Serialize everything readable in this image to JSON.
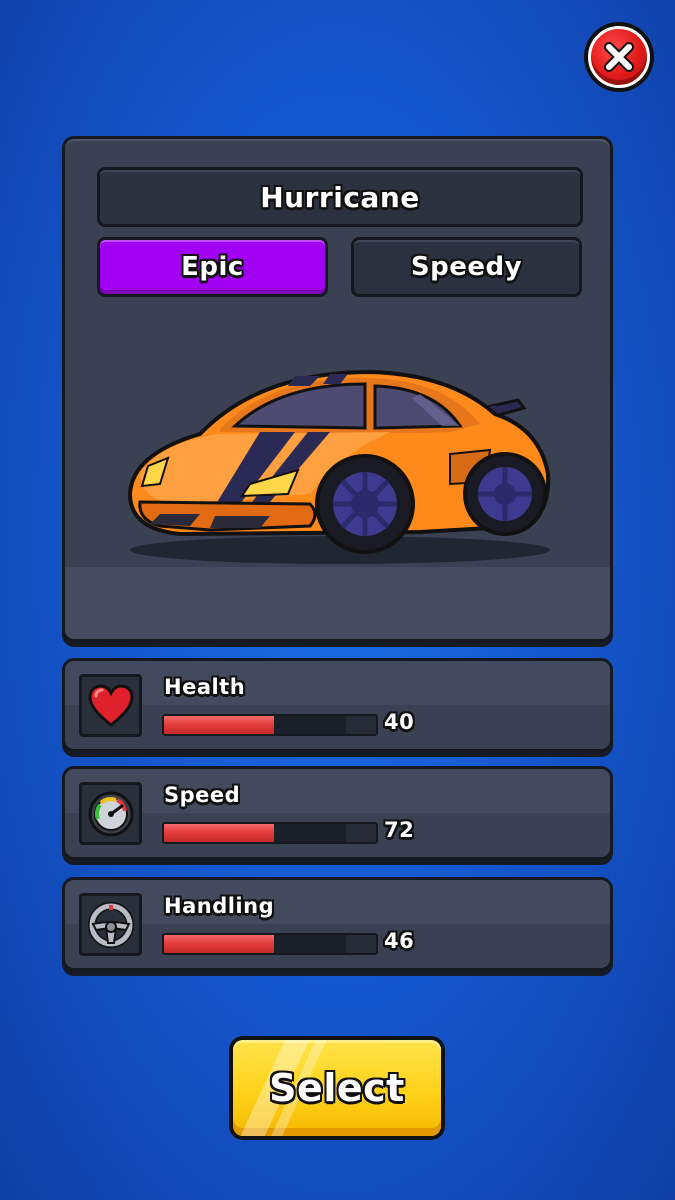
{
  "close_button": {
    "icon": "close-icon"
  },
  "car": {
    "name": "Hurricane",
    "rarity": "Epic",
    "type": "Speedy",
    "rarity_color": "#a200f2",
    "body_color": "#ff8a1c",
    "wheel_color": "#3d3a8f"
  },
  "stats": [
    {
      "label": "Health",
      "icon": "heart-icon",
      "value": "40",
      "level": 0.52
    },
    {
      "label": "Speed",
      "icon": "speedometer-icon",
      "value": "72",
      "level": 0.52
    },
    {
      "label": "Handling",
      "icon": "steering-wheel-icon",
      "value": "46",
      "level": 0.52
    }
  ],
  "select_button": {
    "label": "Select"
  },
  "colors": {
    "background": "#1558cf",
    "panel": "#3a4152",
    "bar_fill": "#e23b3b",
    "select_button": "#ffd21a",
    "close_button": "#e11a1a"
  }
}
